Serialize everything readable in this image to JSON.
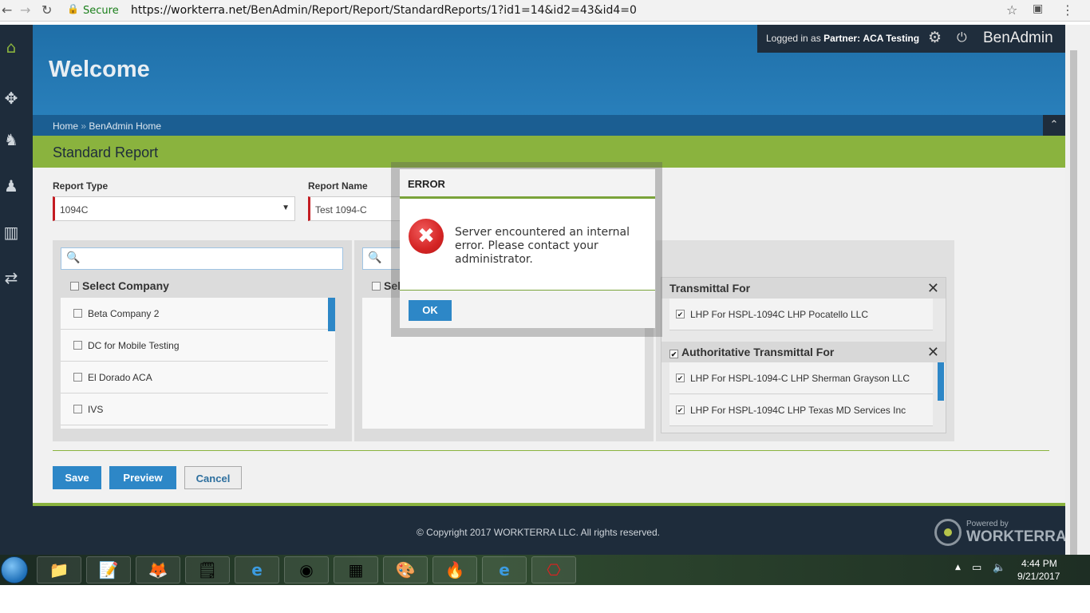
{
  "browser": {
    "secure_label": "Secure",
    "url_host": "https://workterra.net",
    "url_path": "/BenAdmin/Report/Report/StandardReports/1?id1=14&id2=43&id4=0"
  },
  "header": {
    "welcome": "Welcome",
    "logged_in_prefix": "Logged in as ",
    "logged_in_role": "Partner:",
    "logged_in_user": "ACA Testing",
    "brand": "BenAdmin"
  },
  "breadcrumb": {
    "home": "Home",
    "separator": "»",
    "current": "BenAdmin Home"
  },
  "page_title": "Standard Report",
  "form": {
    "report_type_label": "Report Type",
    "report_type_value": "1094C",
    "report_name_label": "Report Name",
    "report_name_value": "Test 1094-C"
  },
  "company_panel": {
    "header": "Select Company",
    "items": [
      "Beta Company 2",
      "DC for Mobile Testing",
      "El Dorado ACA",
      "IVS"
    ]
  },
  "middle_panel": {
    "header_partial": "Sel"
  },
  "transmittal": {
    "header": "Transmittal For",
    "items": [
      "LHP For HSPL-1094C LHP Pocatello LLC"
    ]
  },
  "authoritative": {
    "header": "Authoritative Transmittal For",
    "items": [
      "LHP For HSPL-1094-C LHP Sherman Grayson LLC",
      "LHP For HSPL-1094C LHP Texas MD Services Inc"
    ]
  },
  "buttons": {
    "save": "Save",
    "preview": "Preview",
    "cancel": "Cancel"
  },
  "footer": {
    "copyright": "© Copyright 2017 WORKTERRA LLC. All rights reserved.",
    "powered_by": "Powered by",
    "brand": "WORKTERRA"
  },
  "modal": {
    "title": "ERROR",
    "message": "Server encountered an internal error. Please contact your administrator.",
    "ok": "OK"
  },
  "taskbar": {
    "time": "4:44 PM",
    "date": "9/21/2017"
  },
  "colors": {
    "header_blue": "#2b83bf",
    "accent_green": "#8ab33e",
    "nav_dark": "#1e2c3b",
    "button_blue": "#2d87c7",
    "error_red": "#d42424"
  }
}
